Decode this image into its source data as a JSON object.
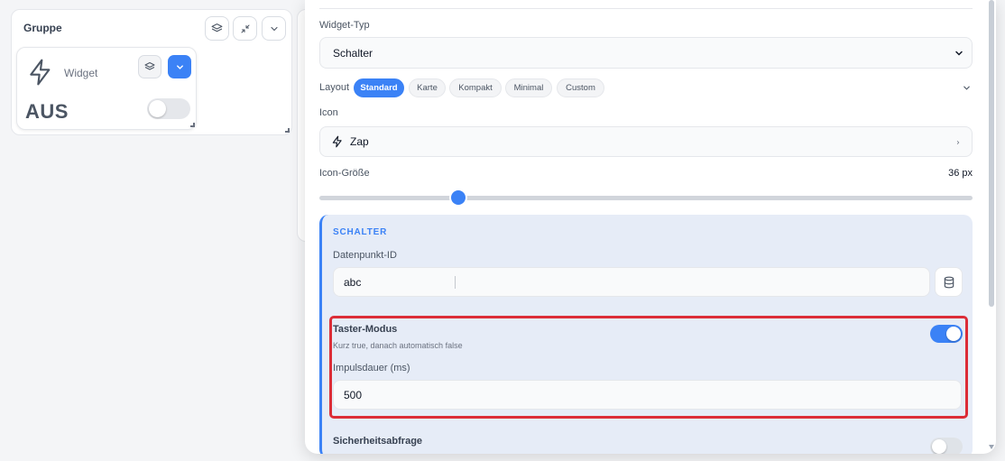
{
  "group": {
    "title": "Gruppe",
    "buttons": [
      {
        "icon": "layers-icon"
      },
      {
        "icon": "minimize-icon"
      },
      {
        "icon": "chevron-down-icon"
      }
    ]
  },
  "widget": {
    "label": "Widget",
    "icon": "zap-icon",
    "state_text": "AUS",
    "toggle_on": false
  },
  "editor": {
    "widget_type_label": "Widget-Typ",
    "widget_type_value": "Schalter",
    "layout_label": "Layout",
    "layouts": [
      {
        "label": "Standard",
        "active": true
      },
      {
        "label": "Karte",
        "active": false
      },
      {
        "label": "Kompakt",
        "active": false
      },
      {
        "label": "Minimal",
        "active": false
      },
      {
        "label": "Custom",
        "active": false
      }
    ],
    "icon_label": "Icon",
    "icon_value": "Zap",
    "icon_size_label": "Icon-Größe",
    "icon_size_value": "36 px",
    "icon_size_fraction": 0.21,
    "section": {
      "title": "SCHALTER",
      "datapoint_label": "Datenpunkt-ID",
      "datapoint_value": "abc",
      "taster_label": "Taster-Modus",
      "taster_desc": "Kurz true, danach automatisch false",
      "taster_on": true,
      "impulse_label": "Impulsdauer (ms)",
      "impulse_value": "500",
      "safety_label": "Sicherheitsabfrage",
      "safety_on": false
    }
  },
  "colors": {
    "accent": "#3b82f6",
    "highlight": "#dc2d37",
    "section_bg": "#e6ecf7"
  }
}
